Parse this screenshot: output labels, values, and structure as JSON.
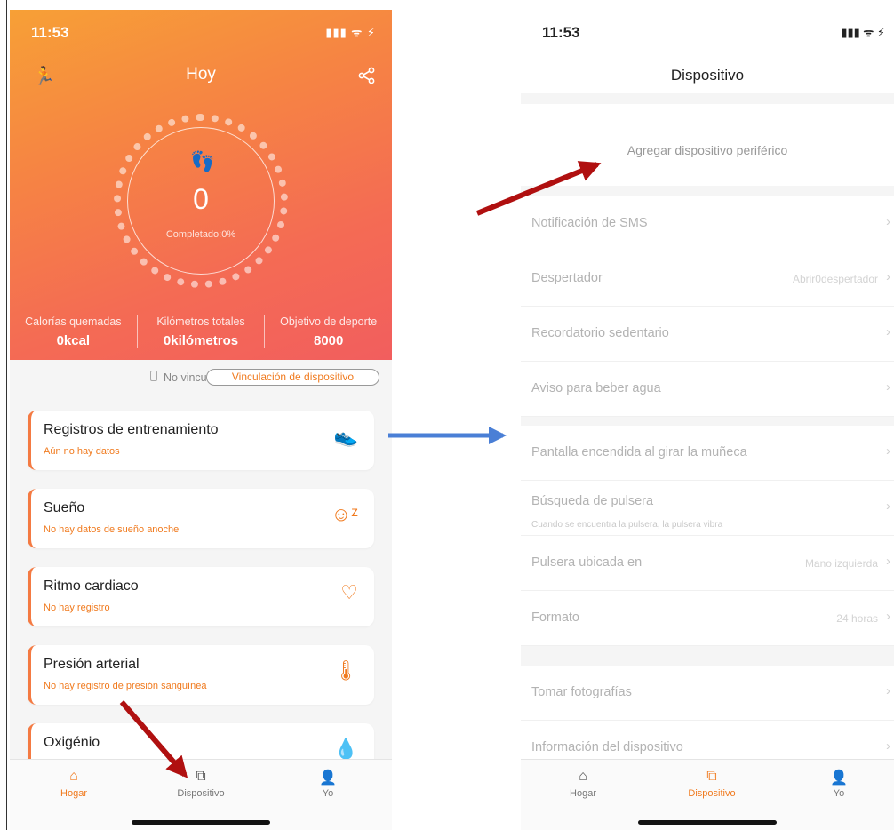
{
  "left": {
    "status": {
      "time": "11:53",
      "signal": "▮▮▮ ᯤ ⚡"
    },
    "header": {
      "title": "Hoy"
    },
    "ring": {
      "steps": "0",
      "completed": "Completado:0%"
    },
    "stats": [
      {
        "label": "Calorías quemadas",
        "value": "0kcal"
      },
      {
        "label": "Kilómetros totales",
        "value": "0kilómetros"
      },
      {
        "label": "Objetivo de deporte",
        "value": "8000"
      }
    ],
    "bind": {
      "status": "No vinculado",
      "button": "Vinculación de dispositivo"
    },
    "cards": [
      {
        "title": "Registros de entrenamiento",
        "sub": "Aún no hay datos",
        "icon": "shoe-icon"
      },
      {
        "title": "Sueño",
        "sub": "No hay datos de sueño anoche",
        "icon": "sleep-face-icon"
      },
      {
        "title": "Ritmo cardiaco",
        "sub": "No hay registro",
        "icon": "heart-icon"
      },
      {
        "title": "Presión arterial",
        "sub": "No hay registro de presión sanguínea",
        "icon": "thermometer-icon"
      },
      {
        "title": "Oxigénio",
        "sub": "",
        "icon": "drop-icon"
      }
    ],
    "tabs": [
      {
        "label": "Hogar"
      },
      {
        "label": "Dispositivo"
      },
      {
        "label": "Yo"
      }
    ]
  },
  "right": {
    "status": {
      "time": "11:53",
      "signal": "▮▮▮ ᯤ ⚡"
    },
    "header": {
      "title": "Dispositivo"
    },
    "add_device": "Agregar dispositivo periférico",
    "rows": {
      "sms": {
        "label": "Notificación de SMS"
      },
      "alarm": {
        "label": "Despertador",
        "value": "Abrir0despertador"
      },
      "sedentary": {
        "label": "Recordatorio sedentario"
      },
      "water": {
        "label": "Aviso para beber agua"
      },
      "wrist": {
        "label": "Pantalla encendida al girar la muñeca"
      },
      "find": {
        "label": "Búsqueda de pulsera",
        "sub": "Cuando se encuentra la pulsera, la pulsera vibra"
      },
      "hand": {
        "label": "Pulsera ubicada en",
        "value": "Mano izquierda"
      },
      "format": {
        "label": "Formato",
        "value": "24 horas"
      },
      "photo": {
        "label": "Tomar fotografías"
      },
      "info": {
        "label": "Información del dispositivo"
      }
    },
    "tabs": [
      {
        "label": "Hogar"
      },
      {
        "label": "Dispositivo"
      },
      {
        "label": "Yo"
      }
    ]
  },
  "colors": {
    "accent": "#f07a1e",
    "hero_start": "#f7a036",
    "hero_end": "#f25e5e",
    "arrow_red": "#b01010",
    "arrow_blue": "#4a7fd6"
  }
}
